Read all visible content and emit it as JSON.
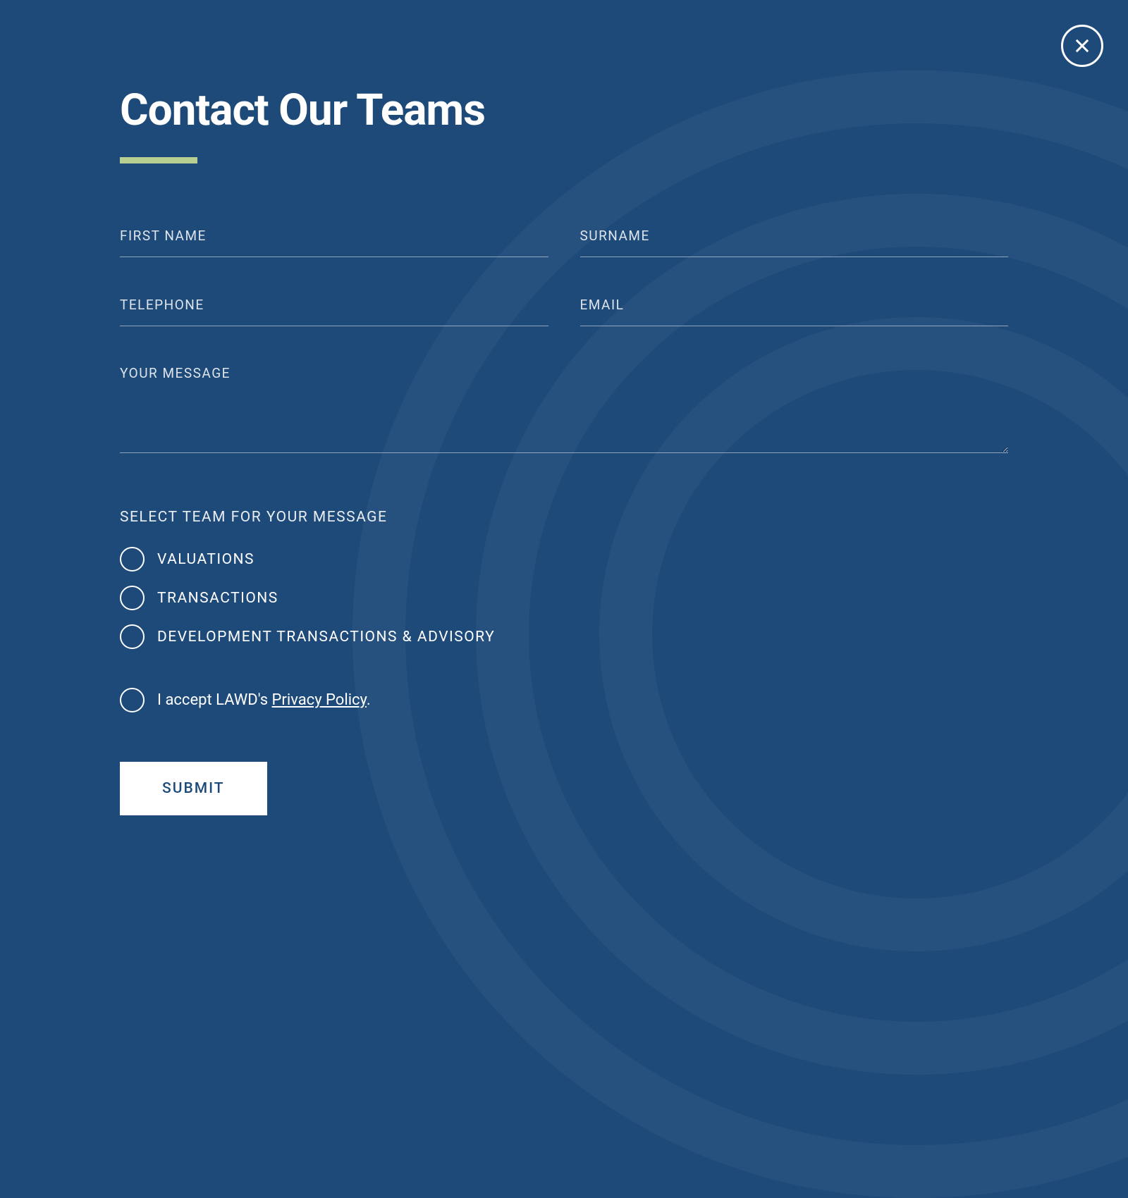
{
  "title": "Contact Our Teams",
  "fields": {
    "firstName": {
      "placeholder": "FIRST NAME",
      "value": ""
    },
    "surname": {
      "placeholder": "SURNAME",
      "value": ""
    },
    "telephone": {
      "placeholder": "TELEPHONE",
      "value": ""
    },
    "email": {
      "placeholder": "EMAIL",
      "value": ""
    },
    "message": {
      "placeholder": "YOUR MESSAGE",
      "value": ""
    }
  },
  "teamSection": {
    "label": "SELECT TEAM FOR YOUR MESSAGE",
    "options": [
      "VALUATIONS",
      "TRANSACTIONS",
      "DEVELOPMENT TRANSACTIONS & ADVISORY"
    ]
  },
  "privacy": {
    "prefix": "I accept LAWD's ",
    "linkText": "Privacy Policy",
    "suffix": "."
  },
  "submitLabel": "SUBMIT"
}
